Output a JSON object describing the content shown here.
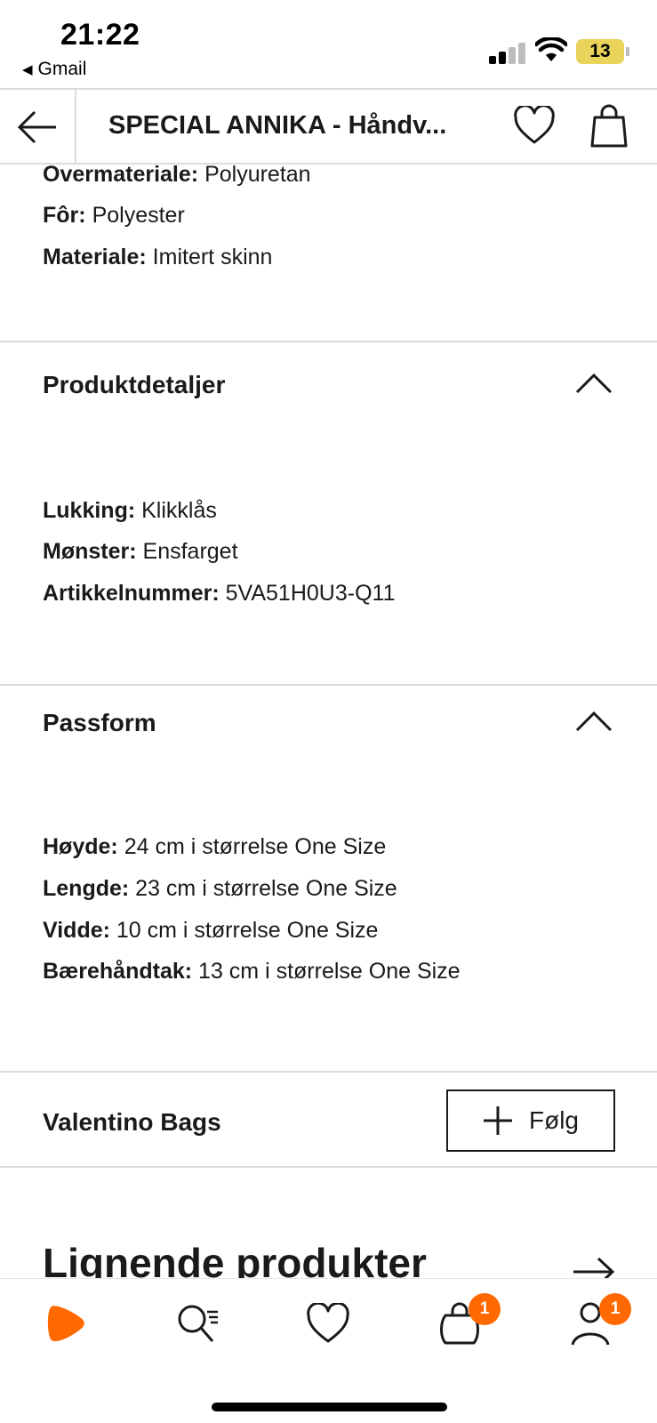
{
  "status_bar": {
    "time": "21:22",
    "back_app": "Gmail",
    "battery": "13",
    "battery_color": "#e9d35a"
  },
  "nav": {
    "title": "SPECIAL ANNIKA - Håndv...",
    "icons": [
      "arrow-left-icon",
      "heart-icon",
      "shopping-bag-icon"
    ]
  },
  "materials": [
    {
      "label": "Overmateriale:",
      "value": "Polyuretan"
    },
    {
      "label": "Fôr:",
      "value": "Polyester"
    },
    {
      "label": "Materiale:",
      "value": "Imitert skinn"
    }
  ],
  "product_details": {
    "title": "Produktdetaljer",
    "rows": [
      {
        "label": "Lukking:",
        "value": "Klikklås"
      },
      {
        "label": "Mønster:",
        "value": "Ensfarget"
      },
      {
        "label": "Artikkelnummer:",
        "value": "5VA51H0U3-Q11"
      }
    ]
  },
  "fit": {
    "title": "Passform",
    "rows": [
      {
        "label": "Høyde:",
        "value": "24 cm i størrelse One Size"
      },
      {
        "label": "Lengde:",
        "value": "23 cm i størrelse One Size"
      },
      {
        "label": "Vidde:",
        "value": "10 cm i størrelse One Size"
      },
      {
        "label": "Bærehåndtak:",
        "value": "13 cm i størrelse One Size"
      }
    ]
  },
  "brand": {
    "name": "Valentino Bags",
    "follow_label": "Følg"
  },
  "similar": {
    "title": "Lignende produkter"
  },
  "tabbar": {
    "items": [
      {
        "name": "home",
        "icon": "zalando-logo-icon"
      },
      {
        "name": "search",
        "icon": "search-icon"
      },
      {
        "name": "wishlist",
        "icon": "heart-icon"
      },
      {
        "name": "bag",
        "icon": "shopping-bag-icon",
        "badge": "1"
      },
      {
        "name": "account",
        "icon": "user-icon",
        "badge": "1"
      }
    ],
    "accent": "#ff6900"
  }
}
